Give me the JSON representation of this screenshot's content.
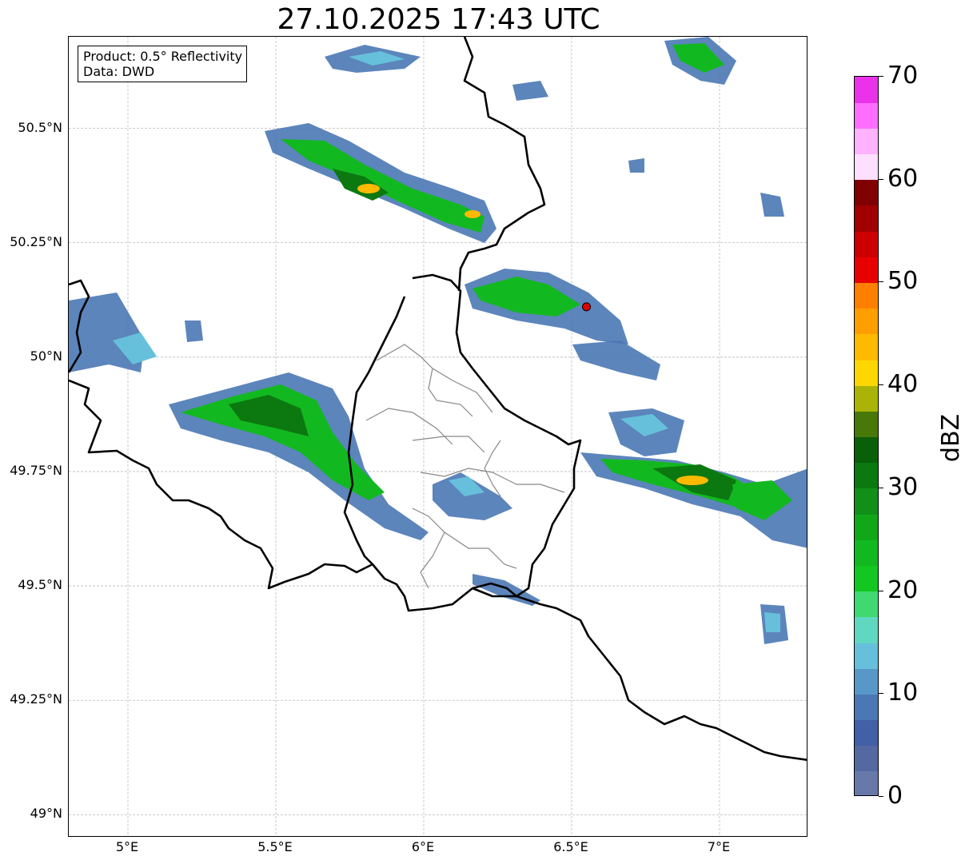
{
  "title": "27.10.2025 17:43 UTC",
  "info": {
    "product": "Product: 0.5° Reflectivity",
    "source": "Data: DWD"
  },
  "map": {
    "extent": {
      "lon_min": 4.8,
      "lon_max": 7.3,
      "lat_min": 48.95,
      "lat_max": 50.7
    },
    "lat_ticks": [
      {
        "value": 50.5,
        "label": "50.5°N"
      },
      {
        "value": 50.25,
        "label": "50.25°N"
      },
      {
        "value": 50.0,
        "label": "50°N"
      },
      {
        "value": 49.75,
        "label": "49.75°N"
      },
      {
        "value": 49.5,
        "label": "49.5°N"
      },
      {
        "value": 49.25,
        "label": "49.25°N"
      },
      {
        "value": 49.0,
        "label": "49°N"
      }
    ],
    "lon_ticks": [
      {
        "value": 5.0,
        "label": "5°E"
      },
      {
        "value": 5.5,
        "label": "5.5°E"
      },
      {
        "value": 6.0,
        "label": "6°E"
      },
      {
        "value": 6.5,
        "label": "6.5°E"
      },
      {
        "value": 7.0,
        "label": "7°E"
      }
    ],
    "gridlines": true,
    "radar_site": {
      "lon": 6.55,
      "lat": 50.11,
      "color": "#e00000"
    },
    "colors": {
      "border": "#000000",
      "subdivision": "#888888",
      "grid": "#bbbbbb"
    }
  },
  "colorbar": {
    "label": "dBZ",
    "min": 0,
    "max": 70,
    "step": 2.5,
    "ticks": [
      {
        "value": 0,
        "label": "0"
      },
      {
        "value": 10,
        "label": "10"
      },
      {
        "value": 20,
        "label": "20"
      },
      {
        "value": 30,
        "label": "30"
      },
      {
        "value": 40,
        "label": "40"
      },
      {
        "value": 50,
        "label": "50"
      },
      {
        "value": 60,
        "label": "60"
      },
      {
        "value": 70,
        "label": "70"
      }
    ],
    "colors": [
      "#6878a8",
      "#5468a2",
      "#4260a6",
      "#4a78b4",
      "#5898c8",
      "#66c0dc",
      "#60d8c0",
      "#40d870",
      "#12c820",
      "#12b820",
      "#10a818",
      "#109018",
      "#0c7810",
      "#0a6008",
      "#487808",
      "#aab408",
      "#ffd700",
      "#ffba00",
      "#ff9e00",
      "#ff8000",
      "#e80000",
      "#cc0000",
      "#a00000",
      "#800000",
      "#ffdfff",
      "#ffb3ff",
      "#ff6dff",
      "#ea32ea"
    ]
  },
  "echo_colors": {
    "weak": "#4a78b4",
    "light": "#66c0dc",
    "moderate": "#12b820",
    "strong": "#0c7810",
    "intense": "#ffba00"
  }
}
